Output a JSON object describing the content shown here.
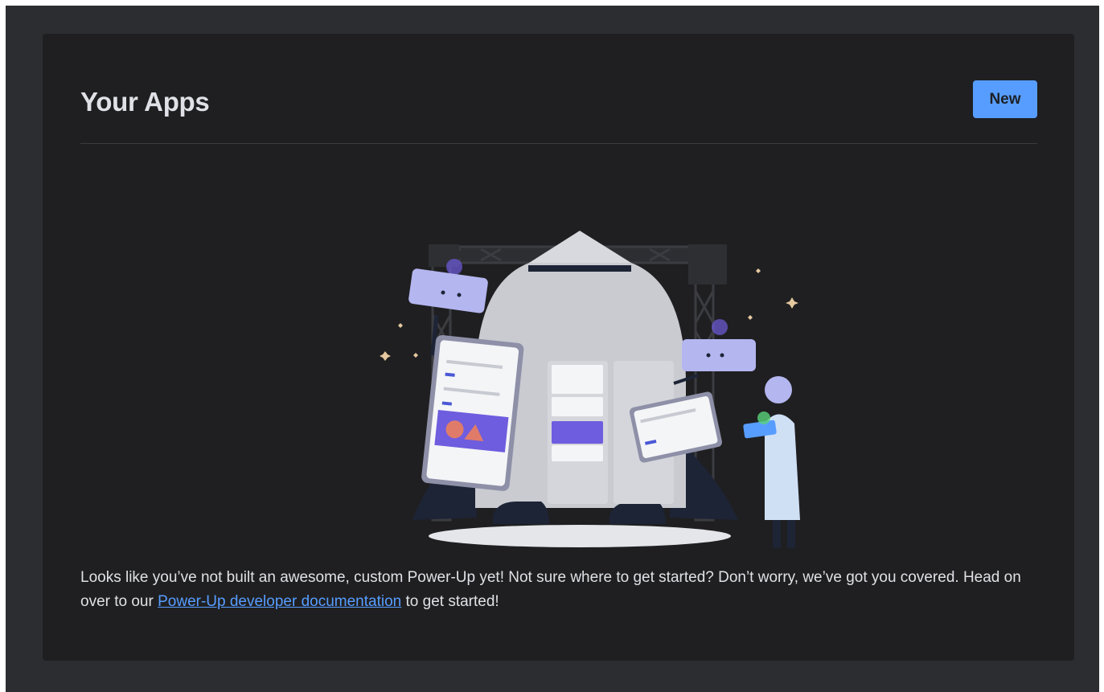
{
  "header": {
    "title": "Your Apps",
    "new_button_label": "New"
  },
  "empty_state": {
    "message_before_link": "Looks like you’ve not built an awesome, custom Power-Up yet! Not sure where to get started? Don’t worry, we’ve got you covered. Head on over to our ",
    "link_text": "Power-Up developer documentation",
    "message_after_link": " to get started!",
    "illustration": "rocket-with-robots-illustration"
  },
  "colors": {
    "page_bg": "#2c2d30",
    "card_bg": "#1f1f21",
    "accent": "#579dff",
    "text": "#dfe1e6"
  }
}
